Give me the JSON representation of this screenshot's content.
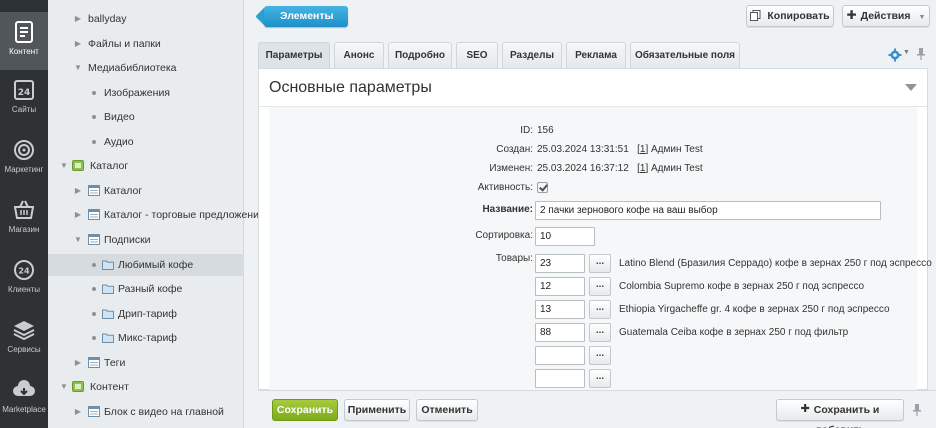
{
  "rail": {
    "items": [
      {
        "label": "Контент",
        "icon": "document-icon",
        "active": true
      },
      {
        "label": "Сайты",
        "icon": "calendar-24-icon"
      },
      {
        "label": "Маркетинг",
        "icon": "target-icon"
      },
      {
        "label": "Магазин",
        "icon": "basket-icon"
      },
      {
        "label": "Клиенты",
        "icon": "clients-24-icon"
      },
      {
        "label": "Сервисы",
        "icon": "layers-icon"
      },
      {
        "label": "Marketplace",
        "icon": "cloud-download-icon"
      }
    ]
  },
  "tree": {
    "items": [
      {
        "label": "ballyday",
        "level": 1,
        "kind": "arrow"
      },
      {
        "label": "Файлы и папки",
        "level": 1,
        "kind": "arrow"
      },
      {
        "label": "Медиабиблиотека",
        "level": 1,
        "kind": "arrow-open"
      },
      {
        "label": "Изображения",
        "level": 2,
        "kind": "bullet"
      },
      {
        "label": "Видео",
        "level": 2,
        "kind": "bullet"
      },
      {
        "label": "Аудио",
        "level": 2,
        "kind": "bullet"
      },
      {
        "label": "Каталог",
        "level": 0,
        "kind": "open-catalog"
      },
      {
        "label": "Каталог",
        "level": 1,
        "kind": "arrow-list"
      },
      {
        "label": "Каталог - торговые предложения",
        "level": 1,
        "kind": "arrow-list"
      },
      {
        "label": "Подписки",
        "level": 1,
        "kind": "open-list"
      },
      {
        "label": "Любимый кофе",
        "level": 2,
        "kind": "bullet-folder",
        "selected": true
      },
      {
        "label": "Разный кофе",
        "level": 2,
        "kind": "bullet-folder"
      },
      {
        "label": "Дрип-тариф",
        "level": 2,
        "kind": "bullet-folder"
      },
      {
        "label": "Микс-тариф",
        "level": 2,
        "kind": "bullet-folder"
      },
      {
        "label": "Теги",
        "level": 1,
        "kind": "arrow-list"
      },
      {
        "label": "Контент",
        "level": 0,
        "kind": "open-catalog"
      },
      {
        "label": "Блок с видео на главной",
        "level": 1,
        "kind": "arrow-list"
      }
    ]
  },
  "topbar": {
    "crumb": "Элементы",
    "copy_label": "Копировать",
    "actions_label": "Действия"
  },
  "tabs": [
    "Параметры",
    "Анонс",
    "Подробно",
    "SEO",
    "Разделы",
    "Реклама",
    "Обязательные поля"
  ],
  "form": {
    "title": "Основные параметры",
    "id_label": "ID:",
    "id_value": "156",
    "created_label": "Создан:",
    "created_date": "25.03.2024 13:31:51",
    "created_user_id": "1",
    "created_user": "Админ Test",
    "changed_label": "Изменен:",
    "changed_date": "25.03.2024 16:37:12",
    "changed_user_id": "1",
    "changed_user": "Админ Test",
    "active_label": "Активность:",
    "active_checked": true,
    "name_label": "Название:",
    "name_value": "2 пачки зернового кофе на ваш выбор",
    "sort_label": "Сортировка:",
    "sort_value": "10",
    "goods_label": "Товары:",
    "goods": [
      {
        "qty": "23",
        "name": "Latino Blend (Бразилия Серрадо) кофе в зернах 250 г под эспрессо"
      },
      {
        "qty": "12",
        "name": "Colombia Supremo кофе в зернах 250 г под эспрессо"
      },
      {
        "qty": "13",
        "name": "Ethiopia Yirgacheffe gr. 4 кофе в зернах 250 г под эспрессо"
      },
      {
        "qty": "88",
        "name": "Guatemala Ceiba кофе в зернах 250 г под фильтр"
      },
      {
        "qty": "",
        "name": ""
      },
      {
        "qty": "",
        "name": ""
      }
    ],
    "dots_label": "..."
  },
  "footer": {
    "save": "Сохранить",
    "apply": "Применить",
    "cancel": "Отменить",
    "save_add": "Сохранить и добавить"
  },
  "colors": {
    "rail_bg": "#2f3235",
    "crumb_blue": "#1e90c8",
    "save_green": "#7cab1c"
  }
}
